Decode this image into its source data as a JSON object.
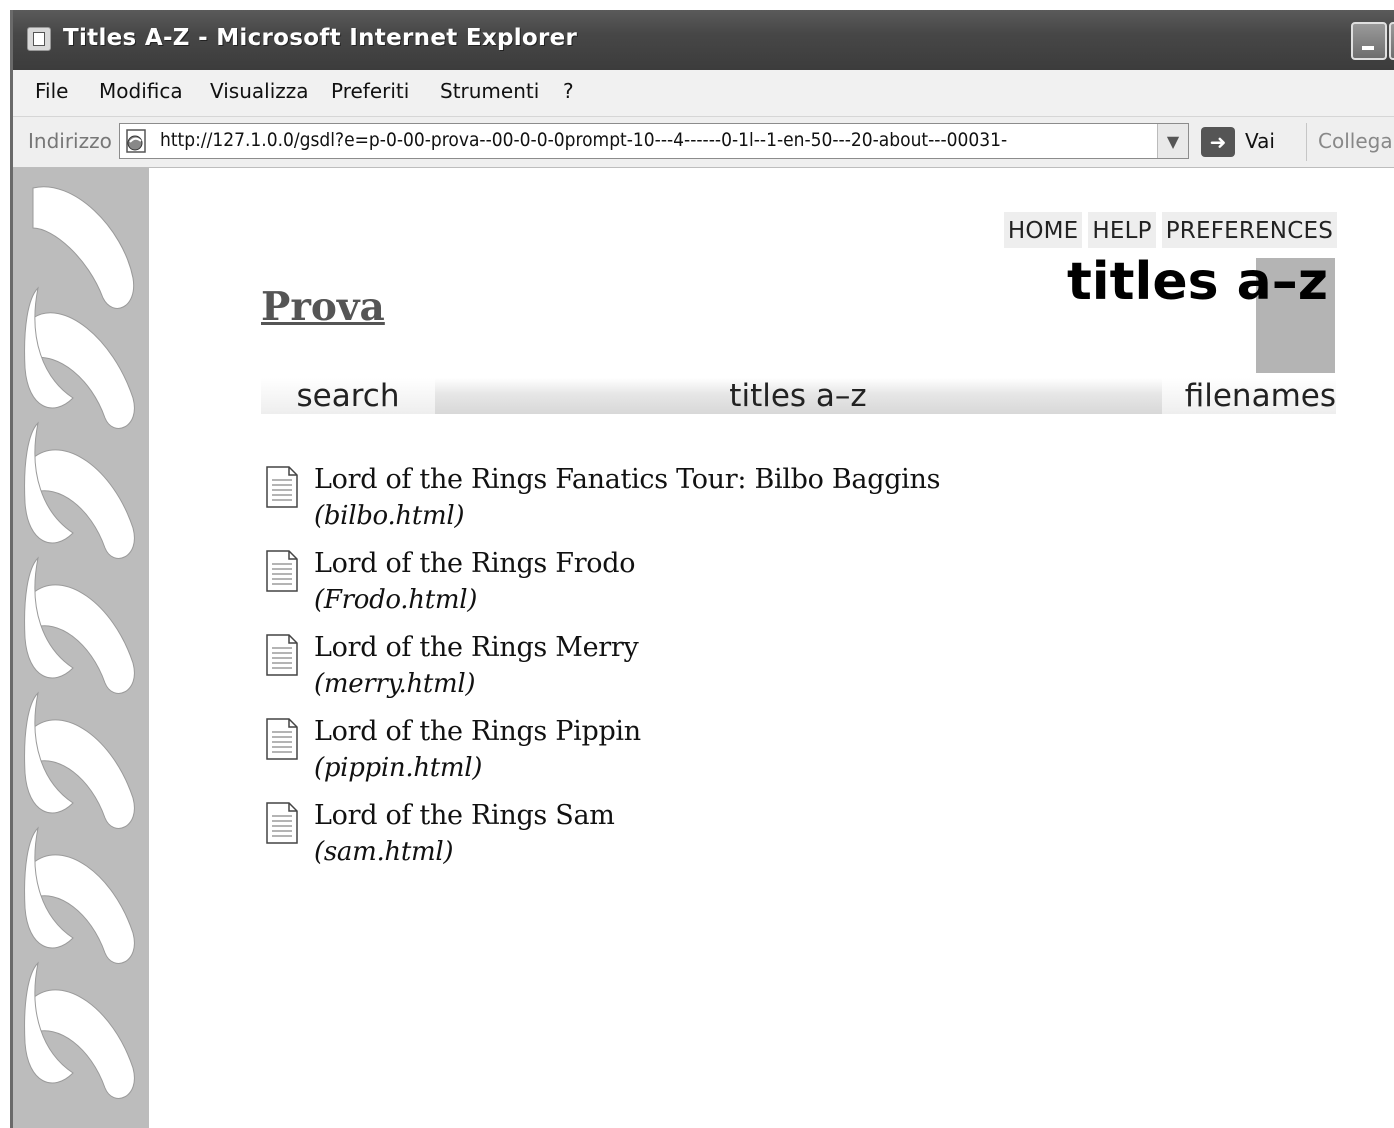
{
  "window": {
    "title": "Titles A-Z - Microsoft Internet Explorer"
  },
  "menu": {
    "items": [
      "File",
      "Modifica",
      "Visualizza",
      "Preferiti",
      "Strumenti",
      "?"
    ]
  },
  "address_bar": {
    "label": "Indirizzo",
    "url": "http://127.1.0.0/gsdl?e=p-0-00-prova--00-0-0-0prompt-10---4------0-1l--1-en-50---20-about---00031-",
    "go_label": "Vai",
    "links_label": "Collegamenti"
  },
  "page": {
    "nav_links": [
      "HOME",
      "HELP",
      "PREFERENCES"
    ],
    "heading": "titles a–z",
    "collection_title": "Prova",
    "navbar": {
      "search": "search",
      "titles": "titles a–z",
      "filenames": "filenames"
    },
    "results": [
      {
        "title": "Lord of the Rings Fanatics Tour: Bilbo Baggins",
        "file": "(bilbo.html)"
      },
      {
        "title": "Lord of the Rings Frodo",
        "file": "(Frodo.html)"
      },
      {
        "title": "Lord of the Rings Merry",
        "file": "(merry.html)"
      },
      {
        "title": "Lord of the Rings Pippin",
        "file": "(pippin.html)"
      },
      {
        "title": "Lord of the Rings Sam",
        "file": "(sam.html)"
      }
    ]
  },
  "colors": {
    "titlebar": "#474747",
    "heading_block": "#b4b4b4",
    "braid_background": "#bcbcbc"
  }
}
